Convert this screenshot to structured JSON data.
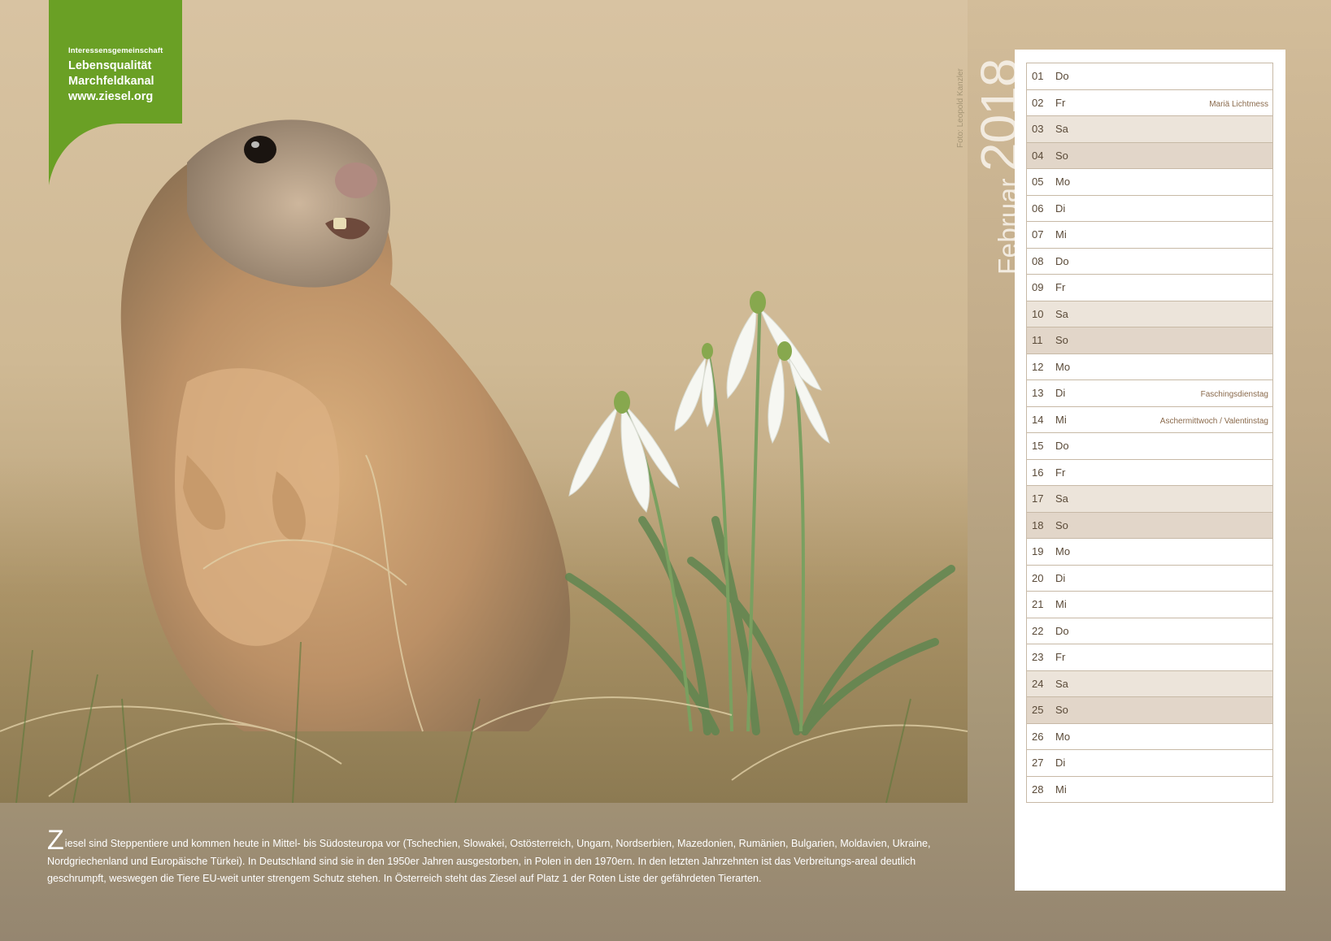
{
  "logo": {
    "small_line": "Interessensgemeinschaft",
    "line1": "Lebensqualität",
    "line2": "Marchfeldkanal",
    "line3": "www.ziesel.org",
    "color": "#6aa025"
  },
  "title": {
    "month": "Februar",
    "year": "2018"
  },
  "photo_credit": "Foto: Leopold Kanzler",
  "calendar": {
    "days": [
      {
        "num": "01",
        "day": "Do",
        "note": "",
        "type": "weekday"
      },
      {
        "num": "02",
        "day": "Fr",
        "note": "Mariä Lichtmess",
        "type": "weekday"
      },
      {
        "num": "03",
        "day": "Sa",
        "note": "",
        "type": "sat"
      },
      {
        "num": "04",
        "day": "So",
        "note": "",
        "type": "sun"
      },
      {
        "num": "05",
        "day": "Mo",
        "note": "",
        "type": "weekday"
      },
      {
        "num": "06",
        "day": "Di",
        "note": "",
        "type": "weekday"
      },
      {
        "num": "07",
        "day": "Mi",
        "note": "",
        "type": "weekday"
      },
      {
        "num": "08",
        "day": "Do",
        "note": "",
        "type": "weekday"
      },
      {
        "num": "09",
        "day": "Fr",
        "note": "",
        "type": "weekday"
      },
      {
        "num": "10",
        "day": "Sa",
        "note": "",
        "type": "sat"
      },
      {
        "num": "11",
        "day": "So",
        "note": "",
        "type": "sun"
      },
      {
        "num": "12",
        "day": "Mo",
        "note": "",
        "type": "weekday"
      },
      {
        "num": "13",
        "day": "Di",
        "note": "Faschingsdienstag",
        "type": "weekday"
      },
      {
        "num": "14",
        "day": "Mi",
        "note": "Aschermittwoch / Valentinstag",
        "type": "weekday"
      },
      {
        "num": "15",
        "day": "Do",
        "note": "",
        "type": "weekday"
      },
      {
        "num": "16",
        "day": "Fr",
        "note": "",
        "type": "weekday"
      },
      {
        "num": "17",
        "day": "Sa",
        "note": "",
        "type": "sat"
      },
      {
        "num": "18",
        "day": "So",
        "note": "",
        "type": "sun"
      },
      {
        "num": "19",
        "day": "Mo",
        "note": "",
        "type": "weekday"
      },
      {
        "num": "20",
        "day": "Di",
        "note": "",
        "type": "weekday"
      },
      {
        "num": "21",
        "day": "Mi",
        "note": "",
        "type": "weekday"
      },
      {
        "num": "22",
        "day": "Do",
        "note": "",
        "type": "weekday"
      },
      {
        "num": "23",
        "day": "Fr",
        "note": "",
        "type": "weekday"
      },
      {
        "num": "24",
        "day": "Sa",
        "note": "",
        "type": "sat"
      },
      {
        "num": "25",
        "day": "So",
        "note": "",
        "type": "sun"
      },
      {
        "num": "26",
        "day": "Mo",
        "note": "",
        "type": "weekday"
      },
      {
        "num": "27",
        "day": "Di",
        "note": "",
        "type": "weekday"
      },
      {
        "num": "28",
        "day": "Mi",
        "note": "",
        "type": "weekday"
      }
    ]
  },
  "description": {
    "initial": "Z",
    "text": "iesel sind Steppentiere und kommen heute in Mittel- bis Südosteuropa vor (Tschechien, Slowakei, Ostösterreich, Ungarn, Nordserbien, Mazedonien, Rumänien, Bulgarien, Moldavien, Ukraine, Nordgriechenland und Europäische Türkei). In Deutschland sind sie in den 1950er Jahren ausgestorben, in Polen in den 1970ern. In den letzten Jahrzehnten ist das Verbreitungs-areal deutlich geschrumpft, weswegen die Tiere EU-weit unter strengem Schutz stehen. In Österreich steht das Ziesel auf Platz 1 der Roten Liste der gefährdeten Tierarten."
  }
}
